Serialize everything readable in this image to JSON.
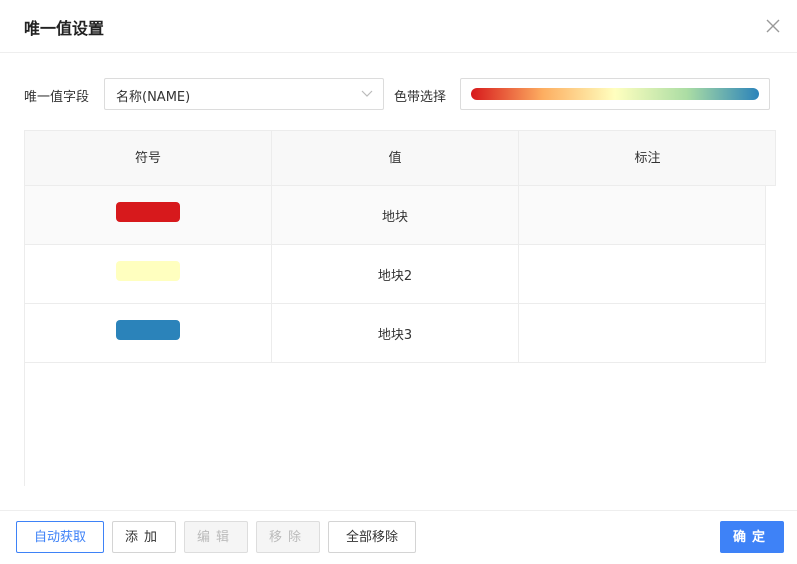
{
  "dialog": {
    "title": "唯一值设置"
  },
  "form": {
    "field_label": "唯一值字段",
    "field_value": "名称(NAME)",
    "ramp_label": "色带选择",
    "ramp_colors": [
      "#d7191c",
      "#fdae61",
      "#ffffbf",
      "#abdda4",
      "#2b83ba"
    ]
  },
  "table": {
    "headers": [
      "符号",
      "值",
      "标注"
    ],
    "rows": [
      {
        "color": "#d7191c",
        "value": "地块",
        "label": ""
      },
      {
        "color": "#ffffbf",
        "value": "地块2",
        "label": ""
      },
      {
        "color": "#2b83ba",
        "value": "地块3",
        "label": ""
      }
    ]
  },
  "footer": {
    "auto_fetch": "自动获取",
    "add": "添加",
    "edit": "编辑",
    "remove": "移除",
    "remove_all": "全部移除",
    "confirm": "确定"
  }
}
